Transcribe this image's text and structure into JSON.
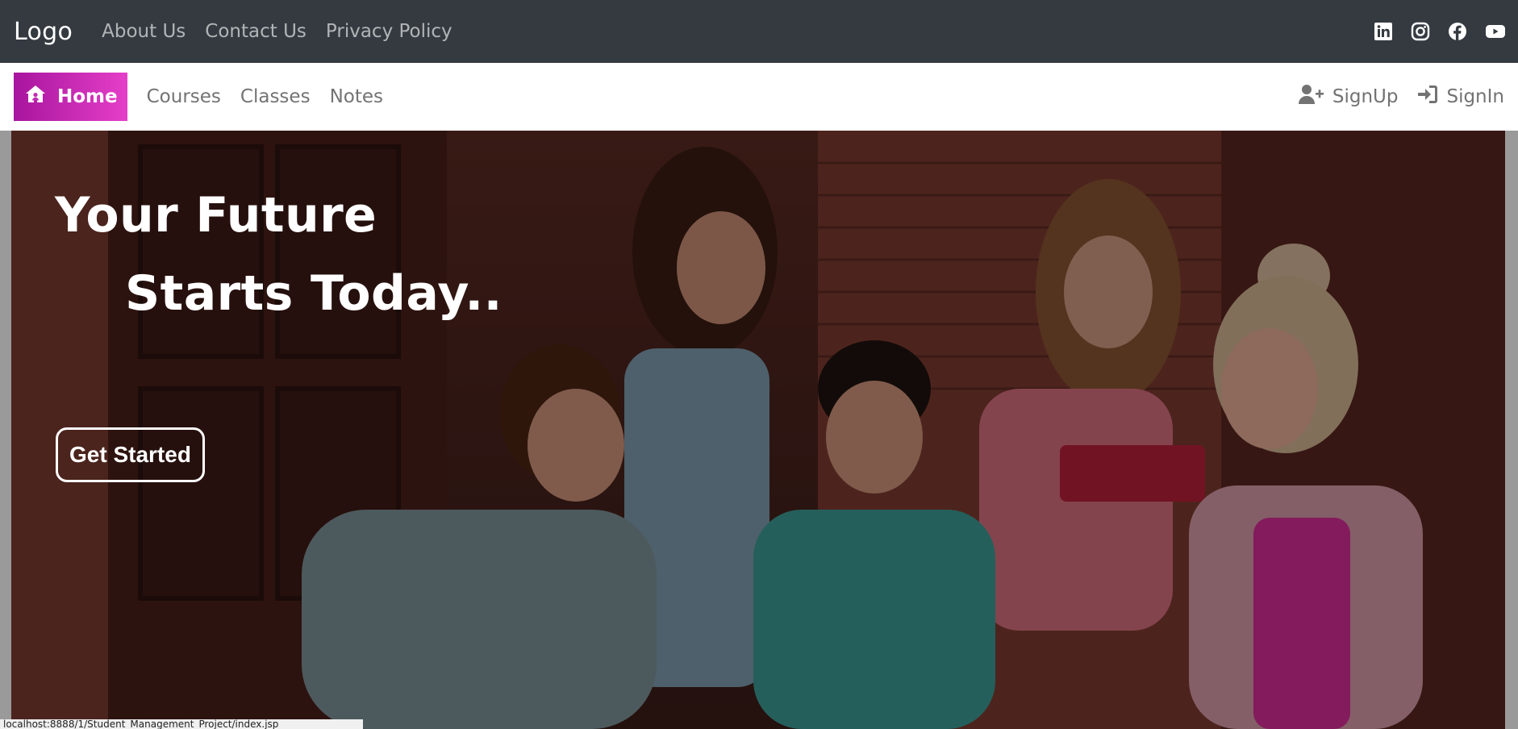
{
  "topbar": {
    "logo": "Logo",
    "links": [
      "About Us",
      "Contact Us",
      "Privacy Policy"
    ],
    "social_icons": [
      "linkedin-icon",
      "instagram-icon",
      "facebook-icon",
      "youtube-icon"
    ]
  },
  "navbar": {
    "home_label": "Home",
    "links": [
      "Courses",
      "Classes",
      "Notes"
    ],
    "signup_label": "SignUp",
    "signin_label": "SignIn",
    "accent_start": "#a8159e",
    "accent_end": "#e53fc8"
  },
  "hero": {
    "line1": "Your Future",
    "line2": "Starts Today..",
    "cta_label": "Get Started"
  },
  "statusbar": {
    "text": "localhost:8888/1/Student_Management_Project/index.jsp"
  }
}
